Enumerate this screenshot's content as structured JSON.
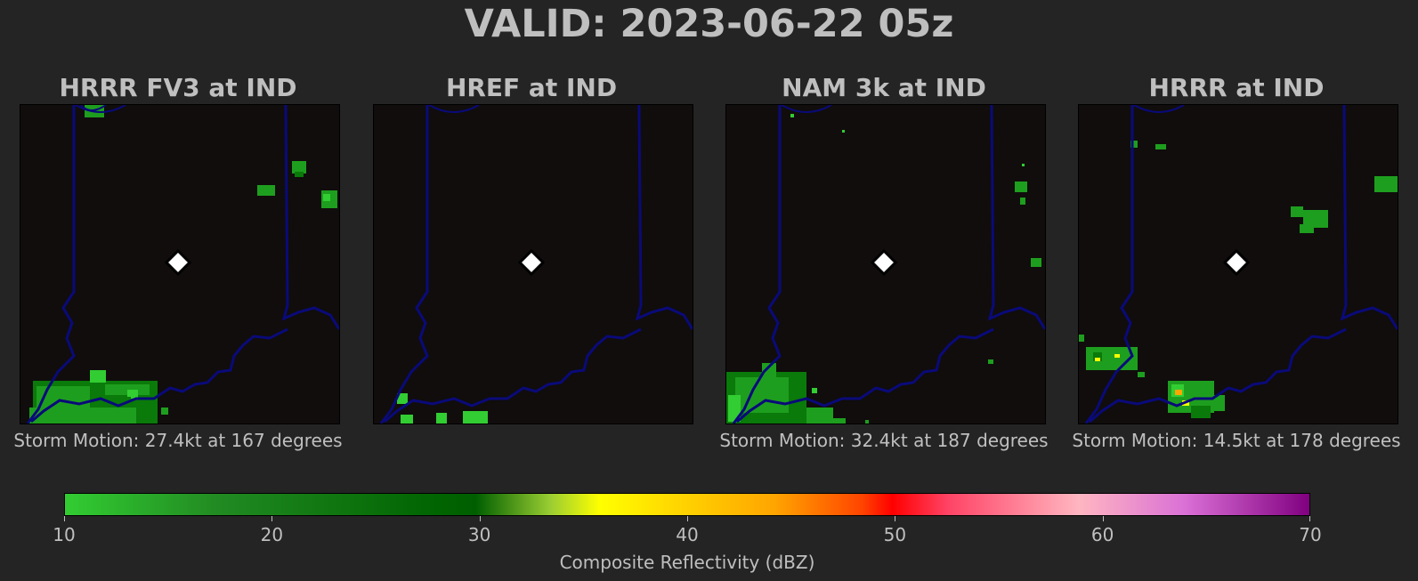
{
  "title": "VALID: 2023-06-22 05z",
  "panels": [
    {
      "title": "HRRR FV3 at IND",
      "storm_motion": "Storm Motion: 27.4kt at 167 degrees"
    },
    {
      "title": "HREF at IND",
      "storm_motion": ""
    },
    {
      "title": "NAM 3k at IND",
      "storm_motion": "Storm Motion: 32.4kt at 187 degrees"
    },
    {
      "title": "HRRR at IND",
      "storm_motion": "Storm Motion: 14.5kt at 178 degrees"
    }
  ],
  "colors": {
    "background": "#242424",
    "map_background": "#100d0c",
    "border_line": "#0a0a7a",
    "station_marker": "#ffffff",
    "echo_light": "#32cd32",
    "echo_medium": "#1e9e1e",
    "echo_dark": "#0a7a0a",
    "echo_yellow": "#ffff00",
    "echo_orange": "#ffa500"
  },
  "chart_data": {
    "type": "heatmap",
    "variable": "Composite Reflectivity",
    "colorbar": {
      "label": "Composite Reflectivity (dBZ)",
      "min": 10,
      "max": 70,
      "ticks": [
        10,
        20,
        30,
        40,
        50,
        60,
        70
      ],
      "tick_labels": [
        "10",
        "20",
        "30",
        "40",
        "50",
        "60",
        "70"
      ],
      "stops": [
        {
          "value": 10,
          "color": "#32cd32"
        },
        {
          "value": 20,
          "color": "#006400"
        },
        {
          "value": 30,
          "color": "#9acd32"
        },
        {
          "value": 35,
          "color": "#ffff00"
        },
        {
          "value": 45,
          "color": "#ffa500"
        },
        {
          "value": 50,
          "color": "#ff0000"
        },
        {
          "value": 60,
          "color": "#ffb6c1"
        },
        {
          "value": 70,
          "color": "#800080"
        }
      ]
    },
    "panels": [
      {
        "model": "HRRR FV3",
        "station": "IND",
        "storm_motion_kt": 27.4,
        "storm_motion_deg": 167
      },
      {
        "model": "HREF",
        "station": "IND"
      },
      {
        "model": "NAM 3k",
        "station": "IND",
        "storm_motion_kt": 32.4,
        "storm_motion_deg": 187
      },
      {
        "model": "HRRR",
        "station": "IND",
        "storm_motion_kt": 14.5,
        "storm_motion_deg": 178
      }
    ]
  }
}
